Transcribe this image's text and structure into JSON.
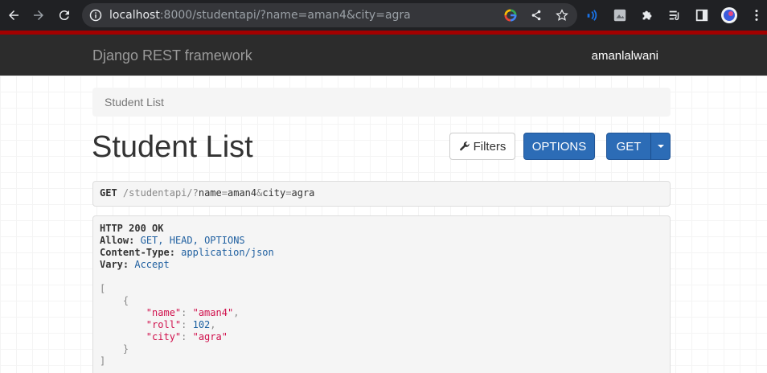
{
  "browser": {
    "url_host": "localhost",
    "url_rest": ":8000/studentapi/?name=aman4&city=agra",
    "icons": [
      "back-arrow-icon",
      "forward-arrow-icon",
      "reload-icon",
      "info-icon",
      "google-icon",
      "share-icon",
      "star-icon",
      "media-icon",
      "extension-image-icon",
      "puzzle-icon",
      "queue-icon",
      "sidebar-icon",
      "profile-avatar",
      "menu-dots-icon"
    ]
  },
  "navbar": {
    "brand": "Django REST framework",
    "username": "amanlalwani"
  },
  "breadcrumb": {
    "label": "Student List"
  },
  "page": {
    "title": "Student List"
  },
  "buttons": {
    "filters": "Filters",
    "options": "OPTIONS",
    "get": "GET"
  },
  "request": {
    "method": "GET",
    "path": "/studentapi/",
    "q": "?",
    "p1k": "name",
    "eq": "=",
    "p1v": "aman4",
    "amp": "&",
    "p2k": "city",
    "p2v": "agra"
  },
  "response": {
    "status": "HTTP 200 OK",
    "headers": [
      {
        "key": "Allow:",
        "value": "GET, HEAD, OPTIONS"
      },
      {
        "key": "Content-Type:",
        "value": "application/json"
      },
      {
        "key": "Vary:",
        "value": "Accept"
      }
    ],
    "body": {
      "open_bracket": "[",
      "open_brace": "{",
      "fields": [
        {
          "key": "\"name\"",
          "value": "\"aman4\"",
          "type": "str",
          "sep": ","
        },
        {
          "key": "\"roll\"",
          "value": "102",
          "type": "num",
          "sep": ","
        },
        {
          "key": "\"city\"",
          "value": "\"agra\"",
          "type": "str",
          "sep": ""
        }
      ],
      "close_brace": "}",
      "close_bracket": "]"
    }
  },
  "colors": {
    "chrome_bg": "#202124",
    "accent_red": "#a30000",
    "navbar_bg": "#2c2c2c",
    "primary_button": "#2c6cb6",
    "json_string": "#d0104c",
    "header_value": "#2060a0"
  }
}
